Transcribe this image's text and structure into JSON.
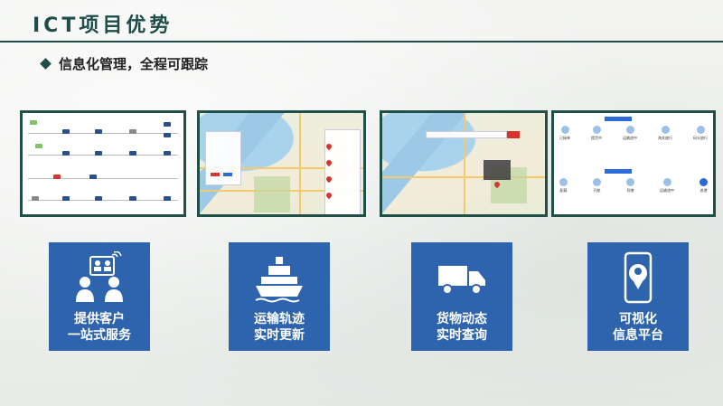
{
  "header": {
    "title": "ICT项目优势"
  },
  "subtitle": {
    "text": "信息化管理，全程可跟踪"
  },
  "screenshots": {
    "shot4": {
      "top_items": [
        "已接单",
        "提货中",
        "运输途中",
        "海关放行",
        "码头放行"
      ],
      "bottom_items": [
        "配载",
        "开航",
        "到港",
        "运输途中",
        "进港"
      ]
    }
  },
  "cards": [
    {
      "icon": "customer-service-icon",
      "label": "提供客户\n一站式服务"
    },
    {
      "icon": "ship-icon",
      "label": "运输轨迹\n实时更新"
    },
    {
      "icon": "truck-icon",
      "label": "货物动态\n实时查询"
    },
    {
      "icon": "map-phone-icon",
      "label": "可视化\n信息平台"
    }
  ],
  "colors": {
    "accent": "#1e4d4a",
    "card": "#2d64ad",
    "highlight": "#d9342b"
  }
}
